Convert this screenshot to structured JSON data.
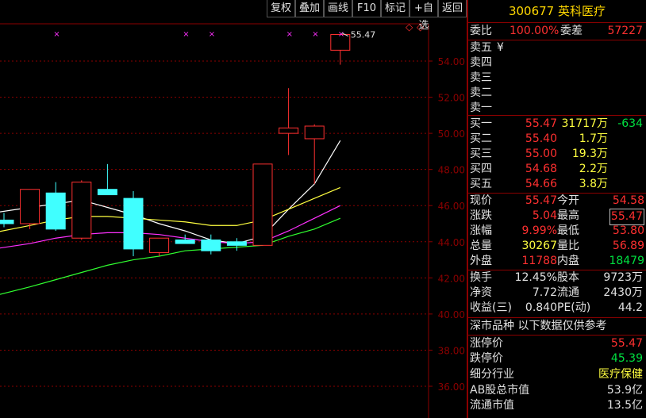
{
  "toolbar": {
    "buttons": [
      "复权",
      "叠加",
      "画线",
      "F10",
      "标记",
      "+自选",
      "返回"
    ]
  },
  "chart": {
    "y_ticks": [
      "54.00",
      "52.00",
      "50.00",
      "48.00",
      "46.00",
      "44.00",
      "42.00",
      "40.00",
      "38.00",
      "36.00"
    ],
    "last_price_label": "55.47",
    "top_marker": "◇",
    "scroll_marker": "◇",
    "colors": {
      "up": "#ff3030",
      "down": "#40ffff",
      "ma_white": "#ffffff",
      "ma_yellow": "#ffff40",
      "ma_magenta": "#ff30ff",
      "ma_green": "#30ff30",
      "grid": "#8b0000"
    }
  },
  "chart_data": {
    "type": "candlestick",
    "ylim": [
      35,
      56
    ],
    "candles": [
      {
        "open": 45.2,
        "high": 45.6,
        "low": 44.8,
        "close": 45.0
      },
      {
        "open": 45.0,
        "high": 46.9,
        "low": 44.7,
        "close": 46.9
      },
      {
        "open": 46.7,
        "high": 47.3,
        "low": 44.6,
        "close": 44.7
      },
      {
        "open": 44.2,
        "high": 47.4,
        "low": 44.1,
        "close": 47.3
      },
      {
        "open": 46.9,
        "high": 48.3,
        "low": 46.6,
        "close": 46.6
      },
      {
        "open": 46.4,
        "high": 46.8,
        "low": 43.2,
        "close": 43.6
      },
      {
        "open": 43.4,
        "high": 44.2,
        "low": 43.2,
        "close": 44.2
      },
      {
        "open": 44.1,
        "high": 44.4,
        "low": 43.9,
        "close": 43.9
      },
      {
        "open": 44.1,
        "high": 44.4,
        "low": 43.3,
        "close": 43.5
      },
      {
        "open": 44.0,
        "high": 44.2,
        "low": 43.5,
        "close": 43.8
      },
      {
        "open": 43.8,
        "high": 48.3,
        "low": 43.8,
        "close": 48.3
      },
      {
        "open": 50.0,
        "high": 52.5,
        "low": 48.8,
        "close": 50.3
      },
      {
        "open": 49.7,
        "high": 50.5,
        "low": 47.2,
        "close": 50.4
      },
      {
        "open": 54.6,
        "high": 55.5,
        "low": 53.8,
        "close": 55.47
      }
    ],
    "ma": [
      {
        "name": "",
        "color": "#ffffff",
        "values": [
          45.6,
          45.9,
          46.1,
          46.3,
          45.9,
          45.5,
          45.0,
          44.6,
          44.1,
          43.9,
          44.3,
          45.8,
          47.2,
          49.6
        ]
      },
      {
        "name": "",
        "color": "#ffff40",
        "values": [
          44.5,
          44.9,
          45.2,
          45.4,
          45.4,
          45.3,
          45.2,
          45.1,
          44.9,
          44.9,
          45.2,
          45.8,
          46.4,
          47.0
        ]
      },
      {
        "name": "",
        "color": "#ff30ff",
        "values": [
          43.6,
          43.9,
          44.2,
          44.4,
          44.5,
          44.5,
          44.4,
          44.2,
          44.0,
          43.9,
          44.0,
          44.6,
          45.3,
          46.0
        ]
      },
      {
        "name": "",
        "color": "#30ff30",
        "values": [
          41.0,
          41.5,
          41.9,
          42.3,
          42.7,
          43.0,
          43.2,
          43.5,
          43.6,
          43.7,
          43.8,
          44.3,
          44.7,
          45.3
        ]
      }
    ],
    "markers_x": [
      2,
      7,
      8,
      11,
      12,
      13
    ]
  },
  "quote": {
    "code": "300677",
    "name": "英科医疗",
    "weibi_label": "委比",
    "weibi_value": "100.00%",
    "weicha_label": "委差",
    "weicha_value": "57227",
    "sell": [
      {
        "label": "卖五",
        "price": "¥",
        "vol": ""
      },
      {
        "label": "卖四",
        "price": "",
        "vol": ""
      },
      {
        "label": "卖三",
        "price": "",
        "vol": ""
      },
      {
        "label": "卖二",
        "price": "",
        "vol": ""
      },
      {
        "label": "卖一",
        "price": "",
        "vol": ""
      }
    ],
    "buy": [
      {
        "label": "买一",
        "price": "55.47",
        "vol": "31717万",
        "chg": "-634"
      },
      {
        "label": "买二",
        "price": "55.40",
        "vol": "1.7万",
        "chg": ""
      },
      {
        "label": "买三",
        "price": "55.00",
        "vol": "19.3万",
        "chg": ""
      },
      {
        "label": "买四",
        "price": "54.68",
        "vol": "2.2万",
        "chg": ""
      },
      {
        "label": "买五",
        "price": "54.66",
        "vol": "3.8万",
        "chg": ""
      }
    ],
    "stats": [
      {
        "l1": "现价",
        "v1": "55.47",
        "c1": "red",
        "l2": "今开",
        "v2": "54.58",
        "c2": "red"
      },
      {
        "l1": "涨跌",
        "v1": "5.04",
        "c1": "red",
        "l2": "最高",
        "v2": "55.47",
        "c2": "red"
      },
      {
        "l1": "涨幅",
        "v1": "9.99%",
        "c1": "red",
        "l2": "最低",
        "v2": "53.80",
        "c2": "red"
      },
      {
        "l1": "总量",
        "v1": "30267",
        "c1": "yellow",
        "l2": "量比",
        "v2": "56.89",
        "c2": "red"
      },
      {
        "l1": "外盘",
        "v1": "11788",
        "c1": "red",
        "l2": "内盘",
        "v2": "18479",
        "c2": "green"
      }
    ],
    "fin": [
      {
        "l1": "换手",
        "v1": "12.45%",
        "l2": "股本",
        "v2": "9723万"
      },
      {
        "l1": "净资",
        "v1": "7.72",
        "l2": "流通",
        "v2": "2430万"
      },
      {
        "l1": "收益(三)",
        "v1": "0.840",
        "l2": "PE(动)",
        "v2": "44.2"
      }
    ],
    "market_line": "深市品种  以下数据仅供参考",
    "limit_up_label": "涨停价",
    "limit_up_value": "55.47",
    "limit_down_label": "跌停价",
    "limit_down_value": "45.39",
    "industry_label": "细分行业",
    "industry_value": "医疗保健",
    "ab_cap_label": "AB股总市值",
    "ab_cap_value": "53.9亿",
    "float_cap_label": "流通市值",
    "float_cap_value": "13.5亿"
  }
}
